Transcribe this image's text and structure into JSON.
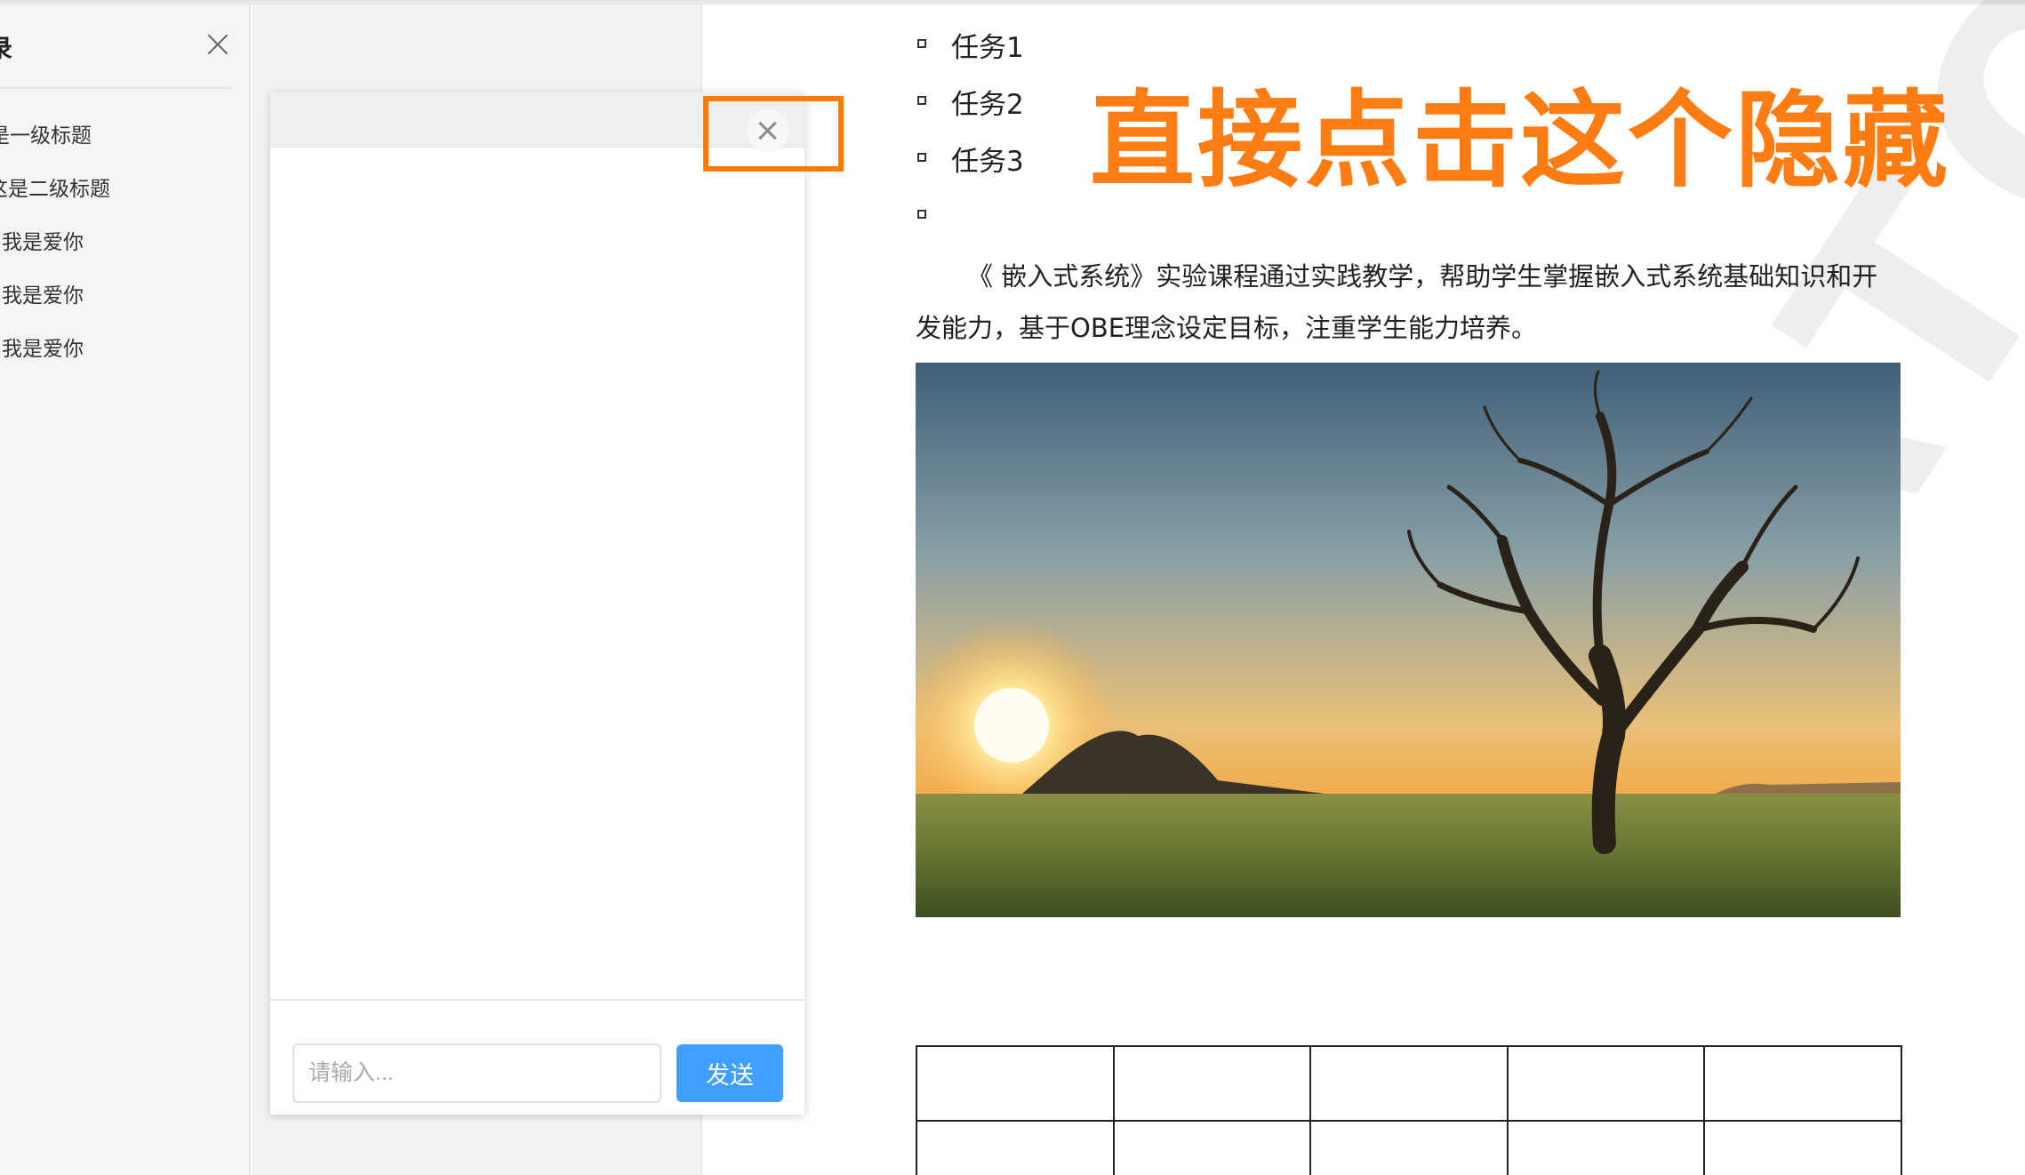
{
  "sidebar": {
    "title": "录",
    "items": [
      {
        "label": "是一级标题"
      },
      {
        "label": "这是二级标题"
      },
      {
        "label": "我是爱你"
      },
      {
        "label": "我是爱你"
      },
      {
        "label": "我是爱你"
      }
    ]
  },
  "chat": {
    "input_placeholder": "请输入...",
    "send_label": "发送"
  },
  "annotation": {
    "text": "直接点击这个隐藏",
    "color": "#ff7c12"
  },
  "document": {
    "tasks": [
      "任务1",
      "任务2",
      "任务3",
      ""
    ],
    "paragraph": "《 嵌入式系统》实验课程通过实践教学，帮助学生掌握嵌入式系统基础知识和开发能力，基于OBE理念设定目标，注重学生能力培养。",
    "watermark": "WATOR"
  },
  "colors": {
    "accent_blue": "#409eff",
    "highlight_orange": "#ff7a00"
  }
}
